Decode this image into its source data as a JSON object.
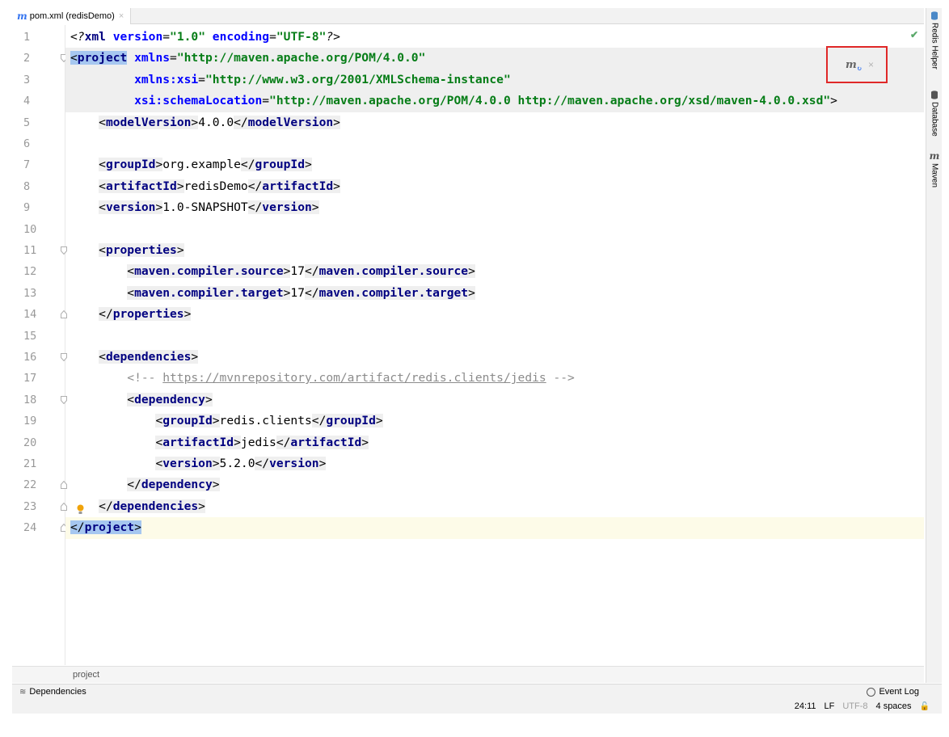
{
  "tab": {
    "icon": "maven-m-icon",
    "title": "pom.xml (redisDemo)",
    "close": "×"
  },
  "right_tools": [
    {
      "label": "Redis Helper",
      "icon": "redis-icon"
    },
    {
      "label": "Database",
      "icon": "database-icon"
    },
    {
      "label": "Maven",
      "icon": "maven-m-icon"
    }
  ],
  "gutter": {
    "numbers": [
      "1",
      "2",
      "3",
      "4",
      "5",
      "6",
      "7",
      "8",
      "9",
      "10",
      "11",
      "12",
      "13",
      "14",
      "15",
      "16",
      "17",
      "18",
      "19",
      "20",
      "21",
      "22",
      "23",
      "24"
    ]
  },
  "code_lines": [
    "<?xml version=\"1.0\" encoding=\"UTF-8\"?>",
    "<project xmlns=\"http://maven.apache.org/POM/4.0.0\"",
    "         xmlns:xsi=\"http://www.w3.org/2001/XMLSchema-instance\"",
    "         xsi:schemaLocation=\"http://maven.apache.org/POM/4.0.0 http://maven.apache.org/xsd/maven-4.0.0.xsd\">",
    "    <modelVersion>4.0.0</modelVersion>",
    "",
    "    <groupId>org.example</groupId>",
    "    <artifactId>redisDemo</artifactId>",
    "    <version>1.0-SNAPSHOT</version>",
    "",
    "    <properties>",
    "        <maven.compiler.source>17</maven.compiler.source>",
    "        <maven.compiler.target>17</maven.compiler.target>",
    "    </properties>",
    "",
    "    <dependencies>",
    "        <!-- https://mvnrepository.com/artifact/redis.clients/jedis -->",
    "        <dependency>",
    "            <groupId>redis.clients</groupId>",
    "            <artifactId>jedis</artifactId>",
    "            <version>5.2.0</version>",
    "        </dependency>",
    "    </dependencies>",
    "</project>"
  ],
  "maven_popup": {
    "icon": "maven-reload-icon",
    "close": "×"
  },
  "inspection_status": "✔",
  "breadcrumb": "project",
  "bottom_tools": {
    "dependencies": "Dependencies",
    "event_log": "Event Log"
  },
  "status": {
    "position": "24:11",
    "line_sep": "LF",
    "encoding": "UTF-8",
    "indent": "4 spaces"
  },
  "colors": {
    "tag": "#000080",
    "attr": "#0000ff",
    "value": "#067d17",
    "comment": "#8c8c8c",
    "selection": "#c6dffb",
    "popup_border": "#e02828"
  }
}
